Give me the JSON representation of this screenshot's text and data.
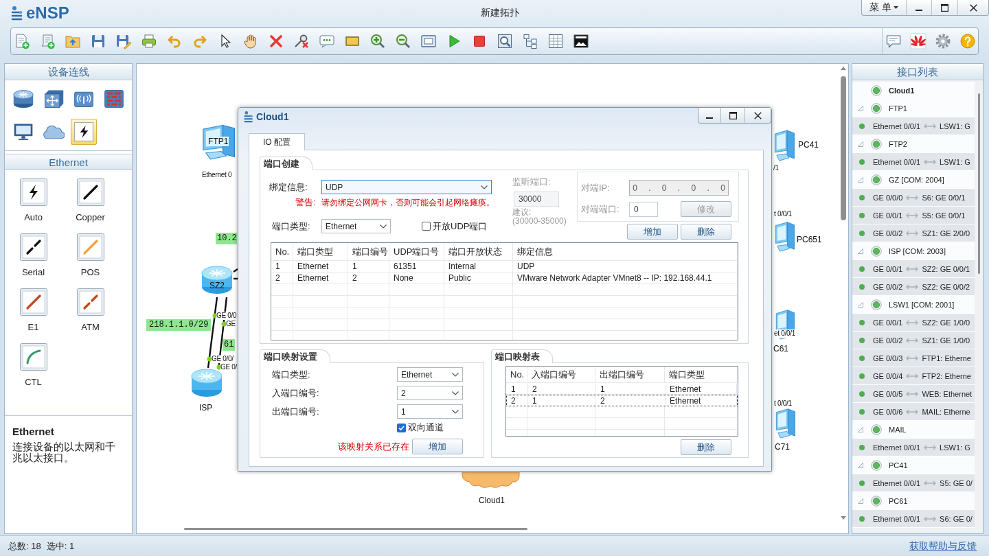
{
  "app": {
    "logo": "eNSP",
    "title": "新建拓扑",
    "menu_button": "菜 单"
  },
  "device_panel": {
    "title": "设备连线",
    "categories": [
      {
        "kind": "router",
        "selected": false
      },
      {
        "kind": "switch",
        "selected": false
      },
      {
        "kind": "wireless",
        "selected": false
      },
      {
        "kind": "firewall",
        "selected": false
      },
      {
        "kind": "pc",
        "selected": false
      },
      {
        "kind": "cloud",
        "selected": false
      },
      {
        "kind": "cable",
        "selected": true
      }
    ],
    "cable_title": "Ethernet",
    "cables": [
      {
        "kind": "auto",
        "label": "Auto"
      },
      {
        "kind": "copper",
        "label": "Copper"
      },
      {
        "kind": "serial",
        "label": "Serial"
      },
      {
        "kind": "pos",
        "label": "POS"
      },
      {
        "kind": "e1",
        "label": "E1"
      },
      {
        "kind": "atm",
        "label": "ATM"
      },
      {
        "kind": "ctl",
        "label": "CTL"
      }
    ],
    "description": {
      "title": "Ethernet",
      "text": "连接设备的以太网和千兆以太接口。"
    }
  },
  "canvas": {
    "nodes": [
      {
        "kind": "pc",
        "label": "FTP1"
      },
      {
        "kind": "router",
        "label": "SZ2"
      },
      {
        "kind": "router",
        "label": "ISP"
      },
      {
        "kind": "pc",
        "label": "PC41"
      },
      {
        "kind": "pc",
        "label": "PC651"
      },
      {
        "kind": "pc",
        "label": "C61"
      },
      {
        "kind": "pc",
        "label": "C71"
      },
      {
        "kind": "cloud",
        "label": "Cloud1"
      }
    ],
    "port_labels": [
      "Ethernet 0",
      "GE 0/0",
      "GE",
      "GE 0/0/",
      "GE 0/",
      "/1",
      "t 0/0/1",
      "et 0/0/1",
      "t 0/0/1"
    ],
    "network_labels": [
      "10.2",
      "218.1.1.0/29",
      "61"
    ]
  },
  "dialog": {
    "title": "Cloud1",
    "tabs": [
      {
        "label": "IO 配置",
        "selected": true
      }
    ],
    "port_create": {
      "title": "端口创建",
      "binding": {
        "label": "绑定信息:",
        "value": "UDP",
        "focused": true
      },
      "warning": {
        "label": "警告:",
        "text": "请勿绑定公网网卡，否则可能会引起网络瘫痪。"
      },
      "port_type": {
        "label": "端口类型:",
        "value": "Ethernet"
      },
      "open_udp": {
        "label": "开放UDP端口",
        "checked": false
      },
      "listen_port": {
        "label": "监听端口:",
        "value": "30000",
        "hint": "建议:",
        "range": "(30000-35000)",
        "disabled": true
      },
      "peer": {
        "ip_label": "对端IP:",
        "ip_value": "0 . 0 . 0 . 0",
        "port_label": "对端端口:",
        "port_value": "0",
        "button": "修改",
        "disabled": true
      },
      "buttons": [
        "增加",
        "删除"
      ],
      "table": {
        "columns": [
          "No.",
          "端口类型",
          "端口编号",
          "UDP端口号",
          "端口开放状态",
          "绑定信息"
        ],
        "rows": [
          [
            "1",
            "Ethernet",
            "1",
            "61351",
            "Internal",
            "UDP"
          ],
          [
            "2",
            "Ethernet",
            "2",
            "None",
            "Public",
            "VMware Network Adapter VMnet8 -- IP: 192.168.44.1"
          ]
        ]
      }
    },
    "mapping_settings": {
      "title": "端口映射设置",
      "fields": [
        {
          "label": "端口类型:",
          "value": "Ethernet"
        },
        {
          "label": "入端口编号:",
          "value": "2"
        },
        {
          "label": "出端口编号:",
          "value": "1"
        }
      ],
      "bidirectional": {
        "label": "双向通道",
        "checked": true
      },
      "error": "该映射关系已存在",
      "button": "增加"
    },
    "mapping_table": {
      "title": "端口映射表",
      "columns": [
        "No.",
        "入端口编号",
        "出端口编号",
        "端口类型"
      ],
      "rows": [
        {
          "cells": [
            "1",
            "2",
            "1",
            "Ethernet"
          ],
          "selected": false
        },
        {
          "cells": [
            "2",
            "1",
            "2",
            "Ethernet"
          ],
          "selected": true
        }
      ],
      "button": "删除"
    }
  },
  "interface_list": {
    "title": "接口列表",
    "devices": [
      {
        "name": "Cloud1",
        "selected": true,
        "expanded": false
      },
      {
        "name": "FTP1",
        "selected": false,
        "expanded": true,
        "children": [
          {
            "port": "Ethernet 0/0/1",
            "peer": "LSW1: G"
          }
        ]
      },
      {
        "name": "FTP2",
        "selected": false,
        "expanded": true,
        "children": [
          {
            "port": "Ethernet 0/0/1",
            "peer": "LSW1: G"
          }
        ]
      },
      {
        "name": "GZ [COM: 2004]",
        "selected": false,
        "expanded": true,
        "children": [
          {
            "port": "GE 0/0/0",
            "peer": "S6: GE 0/0/1"
          },
          {
            "port": "GE 0/0/1",
            "peer": "S5: GE 0/0/1"
          },
          {
            "port": "GE 0/0/2",
            "peer": "SZ1: GE 2/0/0"
          }
        ]
      },
      {
        "name": "ISP [COM: 2003]",
        "selected": false,
        "expanded": true,
        "children": [
          {
            "port": "GE 0/0/1",
            "peer": "SZ2: GE 0/0/1"
          },
          {
            "port": "GE 0/0/2",
            "peer": "SZ2: GE 0/0/2"
          }
        ]
      },
      {
        "name": "LSW1 [COM: 2001]",
        "selected": false,
        "expanded": true,
        "children": [
          {
            "port": "GE 0/0/1",
            "peer": "SZ2: GE 1/0/0"
          },
          {
            "port": "GE 0/0/2",
            "peer": "SZ1: GE 1/0/0"
          },
          {
            "port": "GE 0/0/3",
            "peer": "FTP1: Etherne"
          },
          {
            "port": "GE 0/0/4",
            "peer": "FTP2: Etherne"
          },
          {
            "port": "GE 0/0/5",
            "peer": "WEB: Ethernet"
          },
          {
            "port": "GE 0/0/6",
            "peer": "MAIL: Etherne"
          }
        ]
      },
      {
        "name": "MAIL",
        "selected": false,
        "expanded": true,
        "children": [
          {
            "port": "Ethernet 0/0/1",
            "peer": "LSW1: G"
          }
        ]
      },
      {
        "name": "PC41",
        "selected": false,
        "expanded": true,
        "children": [
          {
            "port": "Ethernet 0/0/1",
            "peer": "S5: GE 0/"
          }
        ]
      },
      {
        "name": "PC61",
        "selected": false,
        "expanded": true,
        "children": [
          {
            "port": "Ethernet 0/0/1",
            "peer": "S6: GE 0/"
          }
        ]
      }
    ]
  },
  "status_bar": {
    "total": "总数: 18",
    "selected": "选中: 1",
    "help_link": "获取帮助与反馈"
  }
}
